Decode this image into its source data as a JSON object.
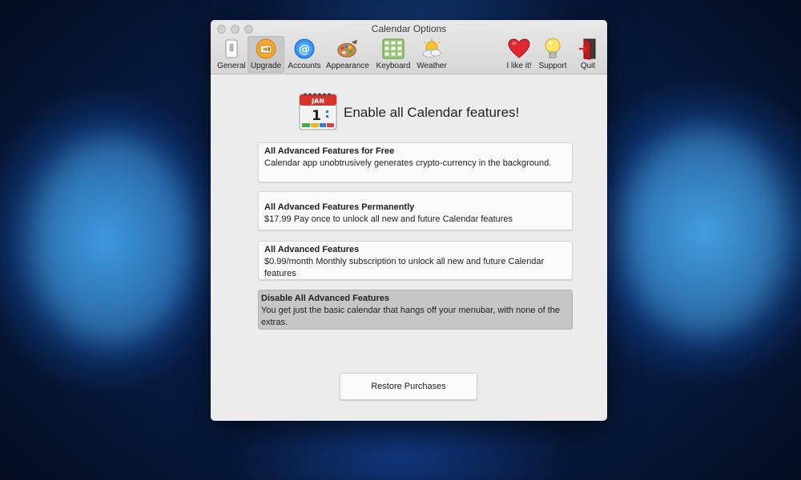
{
  "window": {
    "title": "Calendar Options"
  },
  "toolbar": {
    "items": [
      {
        "label": "General",
        "icon": "switch-icon"
      },
      {
        "label": "Upgrade",
        "icon": "upgrade-icon"
      },
      {
        "label": "Accounts",
        "icon": "at-sign-icon"
      },
      {
        "label": "Appearance",
        "icon": "palette-icon"
      },
      {
        "label": "Keyboard",
        "icon": "keyboard-icon"
      },
      {
        "label": "Weather",
        "icon": "sun-cloud-icon"
      },
      {
        "label": "I like it!",
        "icon": "heart-icon"
      },
      {
        "label": "Support",
        "icon": "lightbulb-icon"
      },
      {
        "label": "Quit",
        "icon": "exit-door-icon"
      }
    ],
    "selected": "Upgrade"
  },
  "hero": {
    "title": "Enable all Calendar features!",
    "calendar_month": "JAN",
    "calendar_day": "1"
  },
  "options": [
    {
      "title": "All Advanced Features for Free",
      "description": "Calendar app unobtrusively generates crypto-currency in the background."
    },
    {
      "title": "All Advanced Features Permanently",
      "description": "$17.99 Pay once to unlock all new and future Calendar features"
    },
    {
      "title": "All Advanced Features",
      "description": "$0.99/month Monthly subscription to unlock all new and future Calendar features"
    },
    {
      "title": "Disable All Advanced Features",
      "description": "You get just the basic calendar that hangs off your menubar, with none of the extras."
    }
  ],
  "restore_button": "Restore Purchases",
  "colors": {
    "accent_orange": "#f0a830",
    "heart_red": "#e0262e",
    "desktop_blue": "#1a6fd8"
  }
}
